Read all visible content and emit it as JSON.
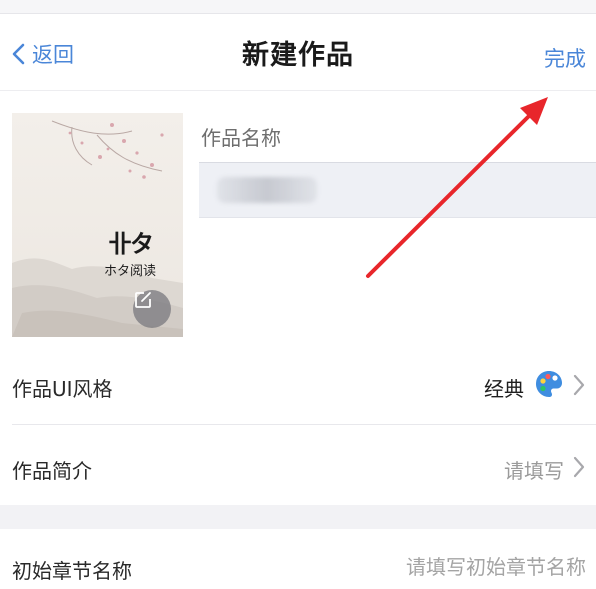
{
  "nav": {
    "back_label": "返回",
    "title": "新建作品",
    "done_label": "完成"
  },
  "cover": {
    "logo_glyph": "卝タ",
    "logo_text": "ホタ阅读"
  },
  "work_name": {
    "label": "作品名称",
    "value": ""
  },
  "rows": {
    "ui_style": {
      "label": "作品UI风格",
      "value": "经典"
    },
    "intro": {
      "label": "作品简介",
      "placeholder": "请填写"
    },
    "first_chapter": {
      "label": "初始章节名称",
      "placeholder": "请填写初始章节名称"
    }
  },
  "colors": {
    "accent": "#4a86d8",
    "annotation_arrow": "#e8262b"
  },
  "icons": {
    "back": "chevron-left-icon",
    "edit": "edit-icon",
    "palette": "palette-icon",
    "arrow": "chevron-right-icon"
  }
}
